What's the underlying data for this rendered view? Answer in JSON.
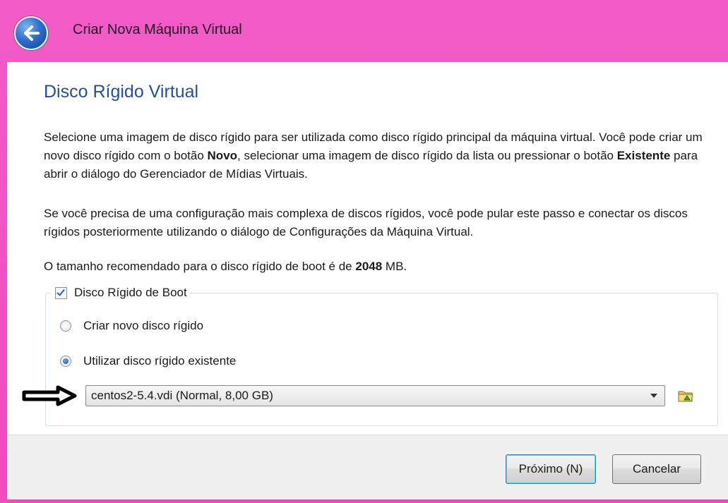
{
  "window": {
    "title": "Criar Nova Máquina Virtual"
  },
  "page": {
    "heading": "Disco Rígido Virtual",
    "p1": {
      "a": "Selecione uma imagem de disco rígido para ser utilizada como disco rígido principal da máquina virtual. Você pode criar um novo disco rígido com o botão ",
      "b1": "Novo",
      "c": ", selecionar uma imagem de disco rígido da lista ou pressionar o botão ",
      "b2": "Existente",
      "d": " para abrir o diálogo do Gerenciador de Mídias Virtuais."
    },
    "p2": "Se você precisa de uma configuração mais complexa de discos rígidos, você pode pular este passo e conectar os discos rígidos posteriormente utilizando o diálogo de Configurações da Máquina Virtual.",
    "p3": {
      "a": "O tamanho recomendado para o disco rígido de boot é de ",
      "size": "2048",
      "unit": " MB."
    }
  },
  "group": {
    "checkbox_label": "Disco Rígido de Boot",
    "checked": true,
    "radio_new": "Criar novo disco rígido",
    "radio_existing": "Utilizar disco rígido existente",
    "selected_radio": "existing",
    "combo_value": "centos2-5.4.vdi (Normal, 8,00 GB)"
  },
  "buttons": {
    "next": "Próximo (N)",
    "cancel": "Cancelar"
  },
  "icons": {
    "back": "back-arrow-icon",
    "folder": "folder-icon",
    "annotation": "arrow-annotation-icon"
  },
  "colors": {
    "frame": "#ef4bbf",
    "heading": "#1f4fa8",
    "accent": "#2f6fd0"
  }
}
